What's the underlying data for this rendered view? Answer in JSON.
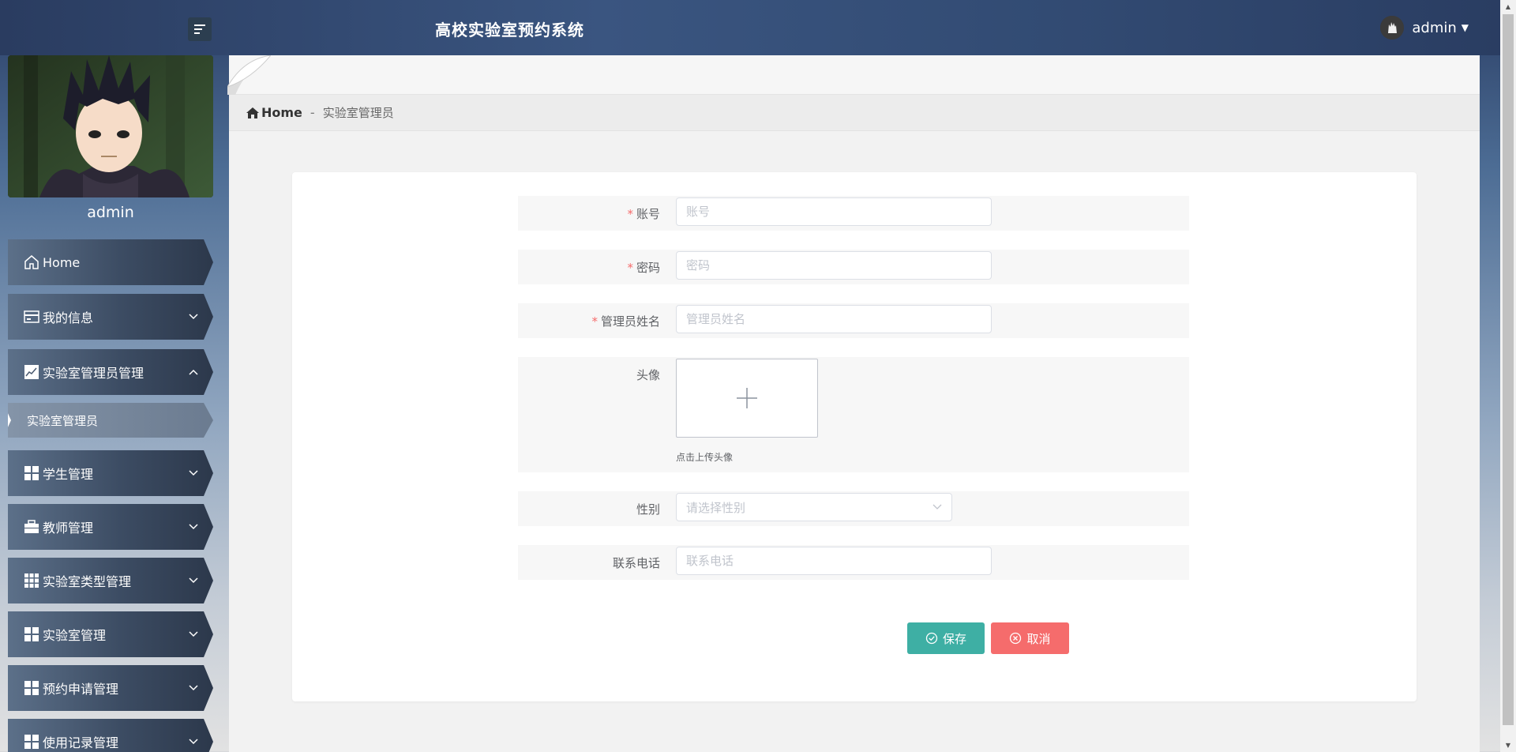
{
  "header": {
    "title": "高校实验室预约系统",
    "username": "admin"
  },
  "sidebar": {
    "username": "admin",
    "items": [
      {
        "label": "Home",
        "icon": "home-icon"
      },
      {
        "label": "我的信息",
        "icon": "card-icon"
      },
      {
        "label": "实验室管理员管理",
        "icon": "chart-icon"
      },
      {
        "label": "学生管理",
        "icon": "grid-icon"
      },
      {
        "label": "教师管理",
        "icon": "briefcase-icon"
      },
      {
        "label": "实验室类型管理",
        "icon": "apps-icon"
      },
      {
        "label": "实验室管理",
        "icon": "grid-icon"
      },
      {
        "label": "预约申请管理",
        "icon": "grid-icon"
      },
      {
        "label": "使用记录管理",
        "icon": "grid-icon"
      }
    ],
    "subitem": {
      "label": "实验室管理员"
    }
  },
  "breadcrumb": {
    "home": "Home",
    "separator": "-",
    "current": "实验室管理员"
  },
  "form": {
    "account": {
      "label": "账号",
      "placeholder": "账号",
      "required": true
    },
    "password": {
      "label": "密码",
      "placeholder": "密码",
      "required": true
    },
    "name": {
      "label": "管理员姓名",
      "placeholder": "管理员姓名",
      "required": true
    },
    "avatar": {
      "label": "头像",
      "tip": "点击上传头像"
    },
    "gender": {
      "label": "性别",
      "placeholder": "请选择性别"
    },
    "phone": {
      "label": "联系电话",
      "placeholder": "联系电话"
    },
    "required_mark": "*",
    "save_label": "保存",
    "cancel_label": "取消"
  },
  "colors": {
    "save": "#3eafa4",
    "cancel": "#f56c6c",
    "required": "#f56c6c"
  }
}
